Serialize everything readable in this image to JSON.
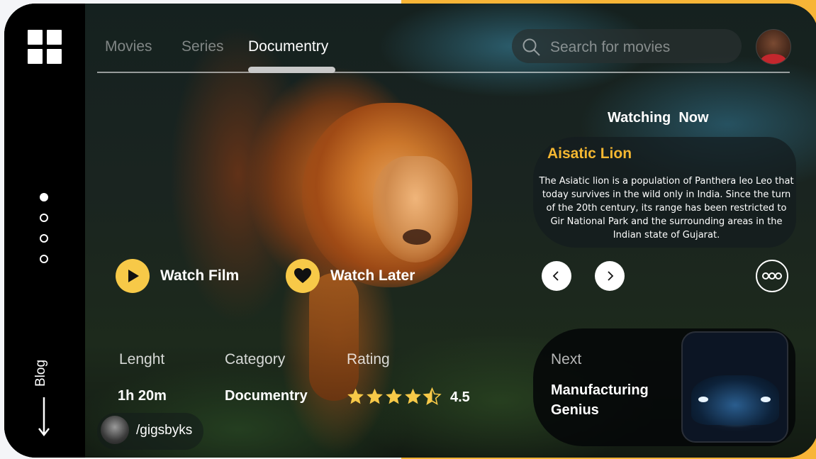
{
  "nav": {
    "tabs": [
      {
        "label": "Movies",
        "active": false
      },
      {
        "label": "Series",
        "active": false
      },
      {
        "label": "Documentry",
        "active": true
      }
    ]
  },
  "search": {
    "placeholder": "Search for movies",
    "value": ""
  },
  "sidebar": {
    "icon": "grid-icon",
    "pagination_total": 4,
    "pagination_active": 1,
    "blog_label": "Blog",
    "blog_icon": "arrow-down-icon"
  },
  "watching_now": {
    "heading": "Watching  Now",
    "title": "Aisatic Lion",
    "description": "The Asiatic lion is a population of Panthera leo Leo that today survives in the wild only in India. Since the turn of the 20th century, its range has been restricted to Gir National Park and the surrounding areas in the Indian state of Gujarat."
  },
  "actions": {
    "watch_film": "Watch Film",
    "watch_later": "Watch Later"
  },
  "stats": {
    "length_label": "Lenght",
    "length_value": "1h 20m",
    "category_label": "Category",
    "category_value": "Documentry",
    "rating_label": "Rating",
    "rating_value": "4.5",
    "rating_stars": 4.5
  },
  "user": {
    "handle": "/gigsbyks"
  },
  "next": {
    "label": "Next",
    "title": "Manufacturing Genius"
  },
  "colors": {
    "accent": "#f7c948",
    "title_accent": "#f5b731",
    "background_right": "#f8b537",
    "sidebar": "#000000"
  }
}
